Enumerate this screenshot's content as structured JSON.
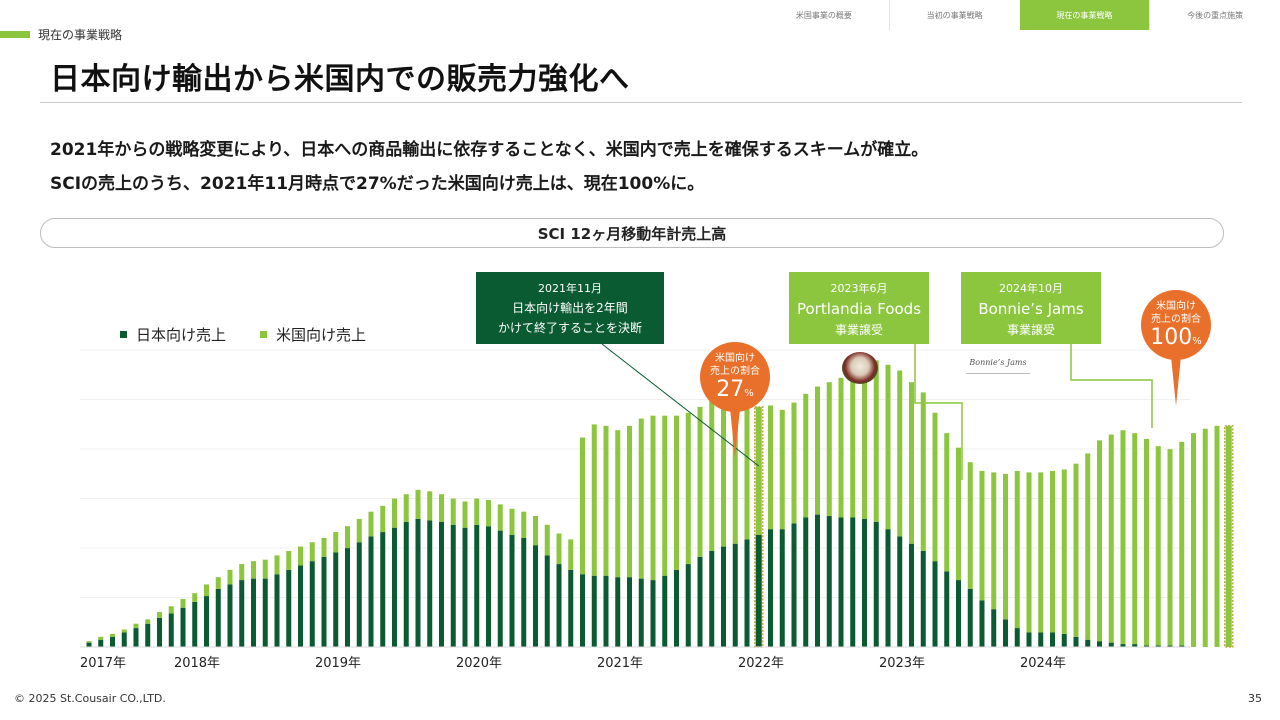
{
  "header": {
    "section_label": "現在の事業戦略",
    "nav": [
      "米国事業の概要",
      "当初の事業戦略",
      "現在の事業戦略",
      "今後の重点施策"
    ],
    "active_nav_index": 2
  },
  "title": "日本向け輸出から米国内での販売力強化へ",
  "lead": {
    "line1": "2021年からの戦略変更により、日本への商品輸出に依存することなく、米国内で売上を確保するスキームが確立。",
    "line2": "SCIの売上のうち、2021年11月時点で27%だった米国向け売上は、現在100%に。"
  },
  "annotations": {
    "decision": {
      "date": "2021年11月",
      "line1": "日本向け輸出を2年間",
      "line2": "かけて終了することを決断"
    },
    "portlandia": {
      "date": "2023年6月",
      "name": "Portlandia Foods",
      "note": "事業譲受"
    },
    "bonnies": {
      "date": "2024年10月",
      "name": "Bonnie’s Jams",
      "note": "事業譲受"
    },
    "share_27": {
      "line1": "米国向け",
      "line2": "売上の割合",
      "value": "27",
      "unit": "%"
    },
    "share_100": {
      "line1": "米国向け",
      "line2": "売上の割合",
      "value": "100",
      "unit": "%"
    },
    "bonnies_logo": "Bonnie’s Jams"
  },
  "colors": {
    "accent": "#8cc63f",
    "japan": "#0a5a32",
    "us": "#8cc63f",
    "bubble": "#e8702a",
    "highlight": "#c9a447"
  },
  "chart_data": {
    "type": "bar",
    "stacked": true,
    "title": "SCI 12ヶ月移動年計売上高",
    "legend": [
      "日本向け売上",
      "米国向け売上"
    ],
    "legend_position": "top-left",
    "y_axis_labels": false,
    "grid": true,
    "start": "2017年",
    "year_labels": [
      "2017年",
      "2018年",
      "2019年",
      "2020年",
      "2021年",
      "2022年",
      "2023年",
      "2024年"
    ],
    "series": [
      {
        "name": "日本向け売上",
        "values": [
          0.3,
          0.5,
          0.7,
          1,
          1.3,
          1.6,
          2,
          2.3,
          2.7,
          3.1,
          3.5,
          4,
          4.3,
          4.6,
          4.7,
          4.7,
          5,
          5.3,
          5.6,
          5.9,
          6.2,
          6.5,
          6.8,
          7.2,
          7.6,
          7.9,
          8.2,
          8.6,
          8.8,
          8.7,
          8.6,
          8.4,
          8.2,
          8.4,
          8.3,
          8,
          7.7,
          7.5,
          7,
          6.3,
          5.7,
          5.3,
          5,
          4.9,
          4.9,
          4.8,
          4.8,
          4.7,
          4.6,
          4.9,
          5.3,
          5.7,
          6.2,
          6.6,
          6.9,
          7.1,
          7.4,
          7.7,
          8.1,
          8.1,
          8.5,
          8.9,
          9.1,
          9,
          8.9,
          8.9,
          8.8,
          8.6,
          8.1,
          7.6,
          7.1,
          6.6,
          5.9,
          5.2,
          4.6,
          4,
          3.2,
          2.6,
          1.9,
          1.3,
          1,
          1,
          1,
          0.9,
          0.7,
          0.5,
          0.4,
          0.3,
          0.2,
          0.2,
          0.1,
          0.1,
          0.1,
          0.1,
          0,
          0,
          0,
          0
        ]
      },
      {
        "name": "米国向け売上",
        "values": [
          0.1,
          0.2,
          0.2,
          0.2,
          0.3,
          0.3,
          0.4,
          0.5,
          0.6,
          0.6,
          0.8,
          0.8,
          1,
          1.1,
          1.2,
          1.3,
          1.3,
          1.3,
          1.3,
          1.3,
          1.3,
          1.4,
          1.5,
          1.6,
          1.7,
          1.8,
          2,
          1.9,
          2,
          2,
          1.9,
          1.8,
          1.8,
          1.8,
          1.8,
          1.8,
          1.8,
          1.8,
          2,
          2.1,
          2.1,
          2.1,
          9.4,
          10.4,
          10.3,
          10.1,
          10.4,
          11,
          11.3,
          11,
          10.6,
          10.4,
          10.3,
          10.5,
          10,
          9.4,
          9,
          8.8,
          8.5,
          8.2,
          8.3,
          8.5,
          8.8,
          9.2,
          9.6,
          10.2,
          10.6,
          11.1,
          11.3,
          11.4,
          11.1,
          10.9,
          10.2,
          9.5,
          9.1,
          8.7,
          8.9,
          9.4,
          10,
          10.8,
          11,
          11,
          11.1,
          11.3,
          11.9,
          12.8,
          13.8,
          14.3,
          14.7,
          14.5,
          14.2,
          13.7,
          13.5,
          14,
          14.7,
          15,
          15.2,
          15.2
        ]
      }
    ],
    "highlight_months": [
      "2021年11月",
      "最新月"
    ]
  },
  "footer": {
    "copyright": "© 2025 St.Cousair CO.,LTD.",
    "page": "35"
  }
}
